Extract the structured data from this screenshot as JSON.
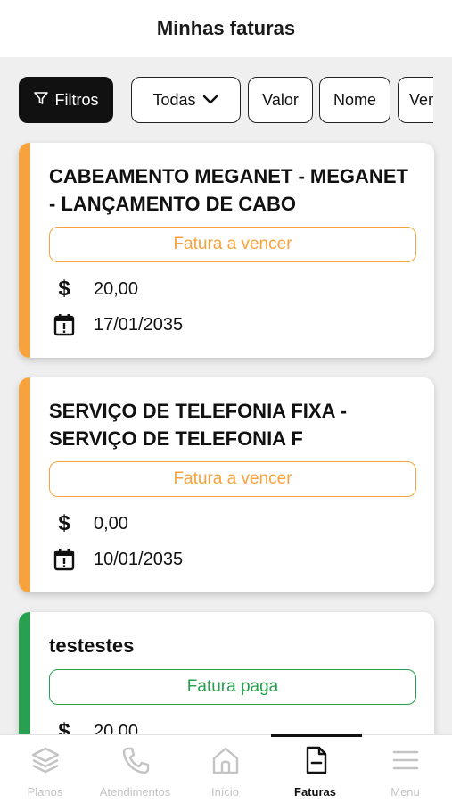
{
  "header": {
    "title": "Minhas faturas"
  },
  "filters": {
    "filter_button": "Filtros",
    "status_select": "Todas",
    "sort_value": "Valor",
    "sort_name": "Nome",
    "sort_due": "Ven"
  },
  "invoices": [
    {
      "title": "CABEAMENTO MEGANET - MEGANET - LANÇAMENTO DE CABO",
      "status": "Fatura a vencer",
      "amount": "20,00",
      "due_date": "17/01/2035",
      "accent": "#f7a23c"
    },
    {
      "title": "SERVIÇO DE TELEFONIA FIXA - SERVIÇO DE TELEFONIA F",
      "status": "Fatura a vencer",
      "amount": "0,00",
      "due_date": "10/01/2035",
      "accent": "#f7a23c"
    },
    {
      "title": "testestes",
      "status": "Fatura paga",
      "amount": "20,00",
      "accent": "#27a04f"
    }
  ],
  "tabbar": {
    "planos": "Planos",
    "atendimentos": "Atendimentos",
    "inicio": "Início",
    "faturas": "Faturas",
    "menu": "Menu"
  },
  "icons": {
    "currency": "dollar-icon",
    "date": "calendar-alert-icon",
    "filter": "funnel-icon",
    "dropdown": "chevron-down-icon"
  }
}
